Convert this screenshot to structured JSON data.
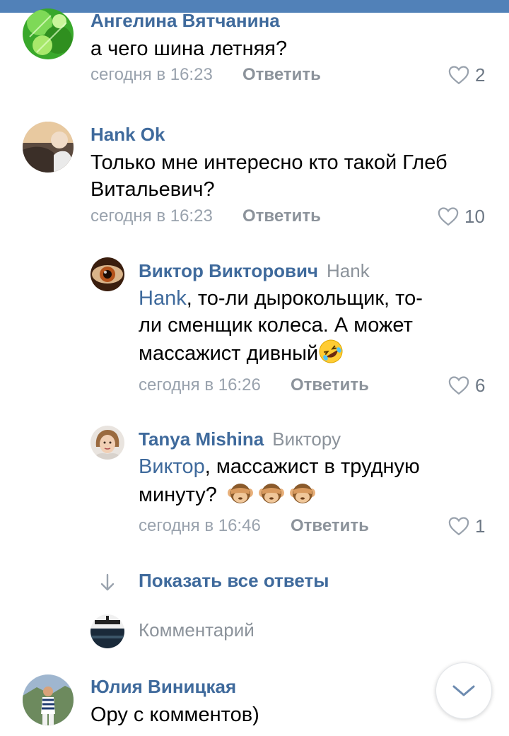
{
  "comments": [
    {
      "author": "Ангелина Вятчанина",
      "text": "а чего шина летняя?",
      "time": "сегодня в 16:23",
      "reply_label": "Ответить",
      "likes": "2"
    },
    {
      "author": "Hank Ok",
      "text": "Только мне интересно кто такой Глеб Витальевич?",
      "time": "сегодня в 16:23",
      "reply_label": "Ответить",
      "likes": "10"
    }
  ],
  "replies": [
    {
      "author": "Виктор Викторович",
      "reply_to": "Hank",
      "mention": "Hank",
      "text": ", то-ли дырокольщик, то-ли сменщик колеса. А может массажист дивный",
      "emoji": "rolling-on-floor-laughing",
      "time": "сегодня в 16:26",
      "reply_label": "Ответить",
      "likes": "6"
    },
    {
      "author": "Tanya Mishina",
      "reply_to": "Виктору",
      "mention": "Виктор",
      "text": ", массажист в трудную минуту?",
      "emoji": "see-no-evil-monkey",
      "time": "сегодня в 16:46",
      "reply_label": "Ответить",
      "likes": "1"
    }
  ],
  "show_all_replies": "Показать все ответы",
  "comment_input": {
    "placeholder": "Комментарий"
  },
  "last_comment": {
    "author": "Юлия Виницкая",
    "text": "Ору с комментов)"
  },
  "colors": {
    "header": "#5181b8",
    "link": "#3f6a9c",
    "meta": "#99a2ad"
  }
}
